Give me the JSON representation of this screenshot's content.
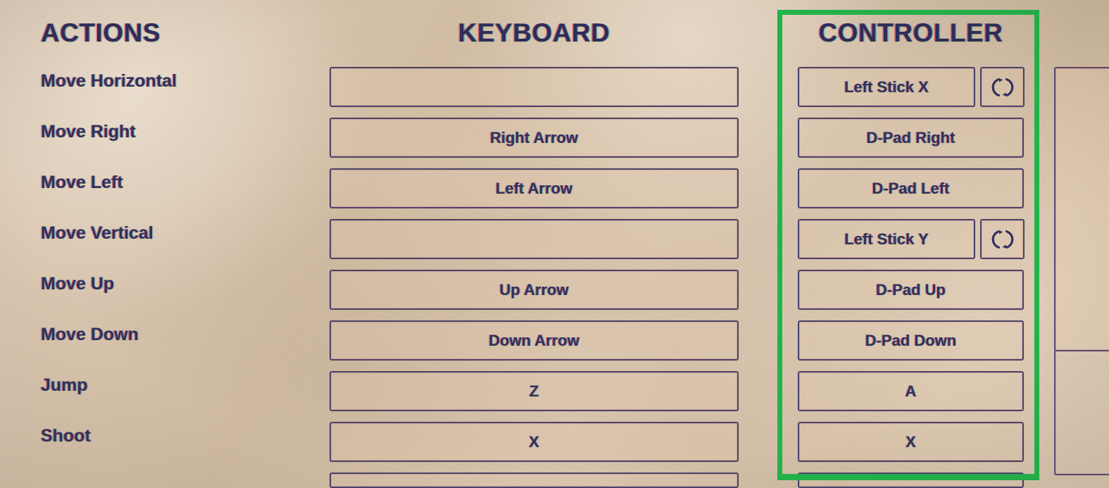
{
  "columns": {
    "actions": "ACTIONS",
    "keyboard": "KEYBOARD",
    "controller": "CONTROLLER"
  },
  "colors": {
    "highlight": "#21b44a",
    "text": "#332f5e",
    "box_border": "#4a4470",
    "paper": "#d8c3ab"
  },
  "highlight": {
    "target": "controller-column",
    "note": "green rectangle outlining the CONTROLLER column"
  },
  "rows": [
    {
      "action": "Move Horizontal",
      "keyboard": "",
      "controller": "Left Stick X",
      "has_invert": true,
      "invert_icon": "swap-axis-icon",
      "partial": false
    },
    {
      "action": "Move Right",
      "keyboard": "Right Arrow",
      "controller": "D-Pad Right",
      "has_invert": false,
      "invert_icon": "",
      "partial": false
    },
    {
      "action": "Move Left",
      "keyboard": "Left Arrow",
      "controller": "D-Pad Left",
      "has_invert": false,
      "invert_icon": "",
      "partial": false
    },
    {
      "action": "Move Vertical",
      "keyboard": "",
      "controller": "Left Stick Y",
      "has_invert": true,
      "invert_icon": "swap-axis-icon",
      "partial": false
    },
    {
      "action": "Move Up",
      "keyboard": "Up Arrow",
      "controller": "D-Pad Up",
      "has_invert": false,
      "invert_icon": "",
      "partial": false
    },
    {
      "action": "Move Down",
      "keyboard": "Down Arrow",
      "controller": "D-Pad Down",
      "has_invert": false,
      "invert_icon": "",
      "partial": false
    },
    {
      "action": "Jump",
      "keyboard": "Z",
      "controller": "A",
      "has_invert": false,
      "invert_icon": "",
      "partial": false
    },
    {
      "action": "Shoot",
      "keyboard": "X",
      "controller": "X",
      "has_invert": false,
      "invert_icon": "",
      "partial": false
    },
    {
      "action": "",
      "keyboard": "",
      "controller": "",
      "has_invert": false,
      "invert_icon": "",
      "partial": true
    }
  ],
  "scrollbar": {
    "name": "vertical-scrollbar",
    "thumb_position": "top"
  }
}
